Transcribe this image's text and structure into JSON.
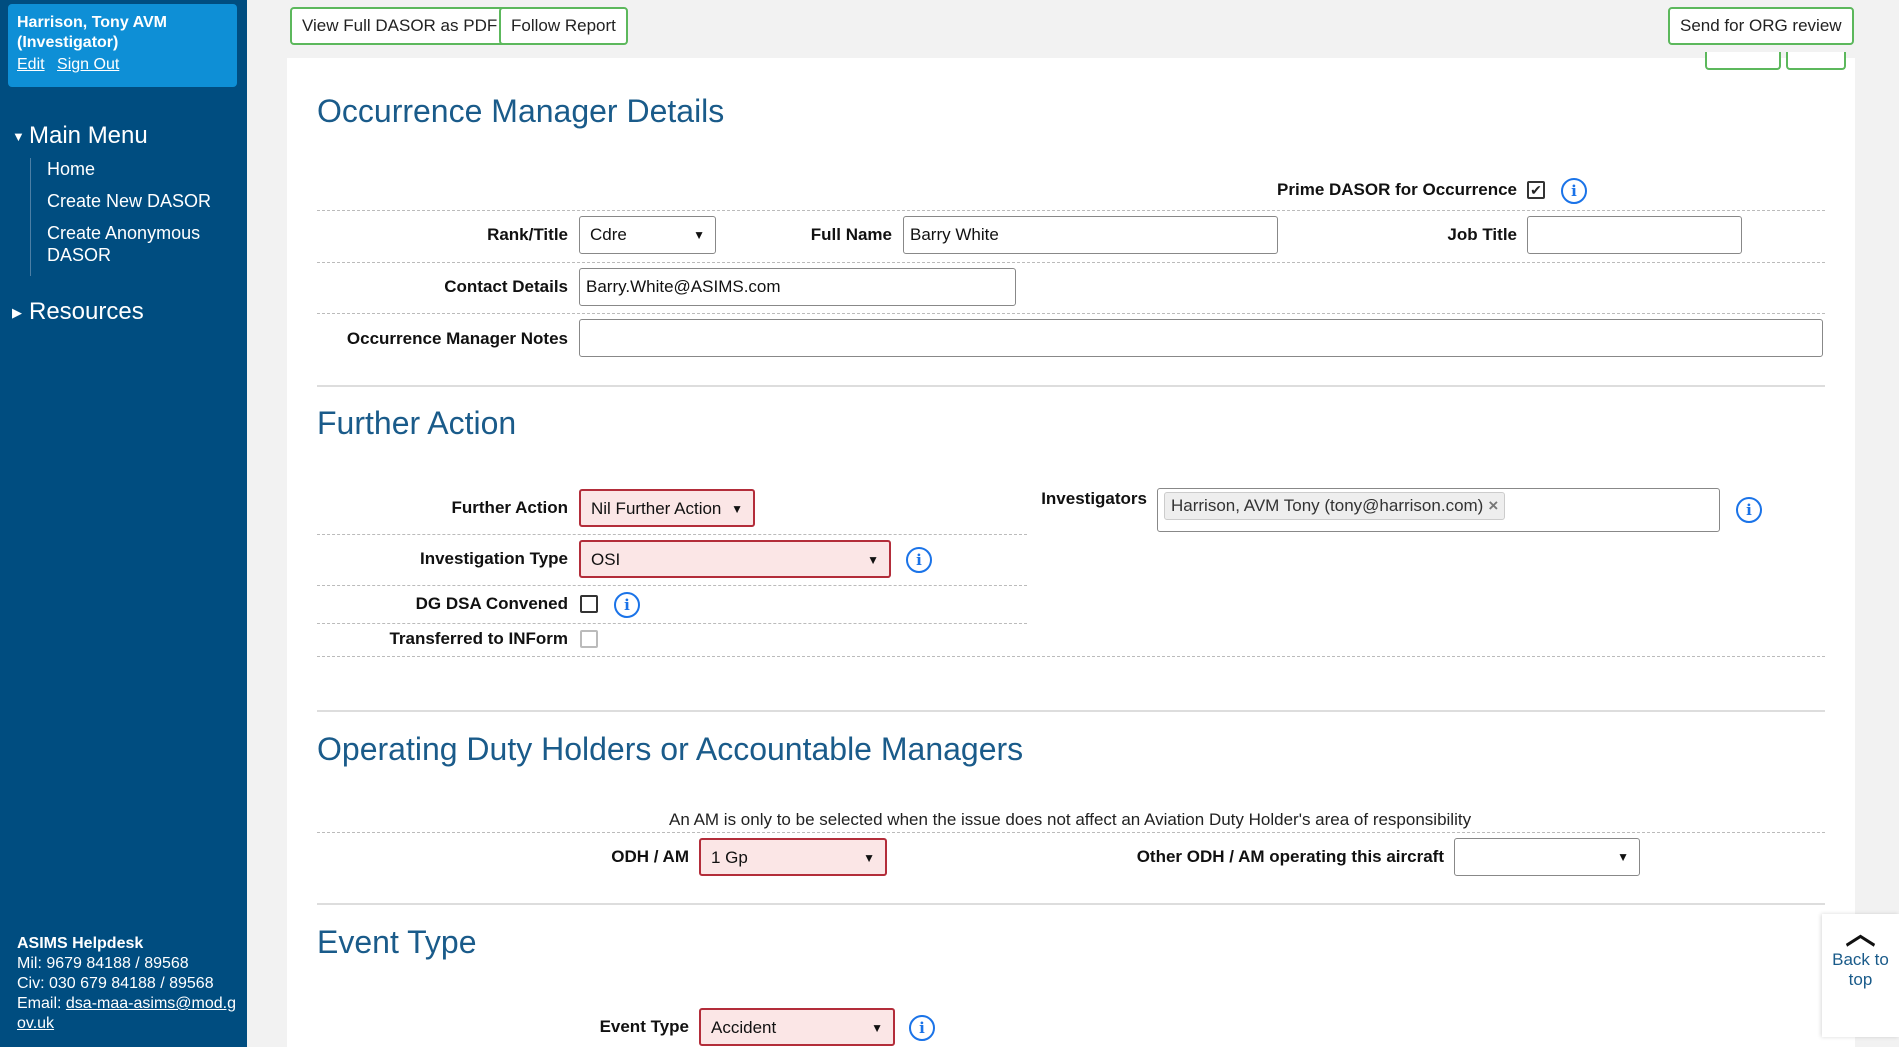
{
  "sidebar": {
    "user_name": "Harrison, Tony AVM (Investigator)",
    "edit_link": "Edit",
    "signout_link": "Sign Out",
    "main_menu": "Main Menu",
    "menu_items": [
      "Home",
      "Create New DASOR",
      "Create Anonymous DASOR"
    ],
    "resources": "Resources",
    "helpdesk_title": "ASIMS Helpdesk",
    "helpdesk_mil": "Mil: 9679 84188 / 89568",
    "helpdesk_civ": "Civ: 030 679 84188 / 89568",
    "helpdesk_email_label": "Email:",
    "helpdesk_email": "dsa-maa-asims@mod.gov.uk"
  },
  "toolbar": {
    "view_pdf": "View Full DASOR as PDF",
    "follow_report": "Follow Report",
    "send_org_review": "Send for ORG review"
  },
  "occurrence_manager": {
    "heading": "Occurrence Manager Details",
    "prime_label": "Prime DASOR for Occurrence",
    "prime_checked": "✔",
    "rank_label": "Rank/Title",
    "rank_value": "Cdre",
    "full_name_label": "Full Name",
    "full_name_value": "Barry White",
    "job_title_label": "Job Title",
    "job_title_value": "",
    "contact_label": "Contact Details",
    "contact_value": "Barry.White@ASIMS.com",
    "notes_label": "Occurrence Manager Notes",
    "notes_value": ""
  },
  "further_action": {
    "heading": "Further Action",
    "further_action_label": "Further Action",
    "further_action_value": "Nil Further Action",
    "investigation_type_label": "Investigation Type",
    "investigation_type_value": "OSI",
    "dg_dsa_label": "DG DSA Convened",
    "inform_label": "Transferred to INForm",
    "investigators_label": "Investigators",
    "investigator_tag": "Harrison, AVM Tony (tony@harrison.com)"
  },
  "odh": {
    "heading": "Operating Duty Holders or Accountable Managers",
    "note": "An AM is only to be selected when the issue does not affect an Aviation Duty Holder's area of responsibility",
    "odh_label": "ODH / AM",
    "odh_value": "1 Gp",
    "other_label": "Other ODH / AM operating this aircraft",
    "other_value": ""
  },
  "event_type": {
    "heading": "Event Type",
    "label": "Event Type",
    "value": "Accident"
  },
  "back_to_top": "Back to top",
  "icons": {
    "info": "i",
    "chevron": "⌄",
    "caret_up": "^"
  },
  "colors": {
    "sidebar": "#004d80",
    "user_box": "#0e8fd6",
    "heading": "#1a5b8a",
    "button_border": "#5cb85c",
    "invalid": "#b32d3a"
  }
}
